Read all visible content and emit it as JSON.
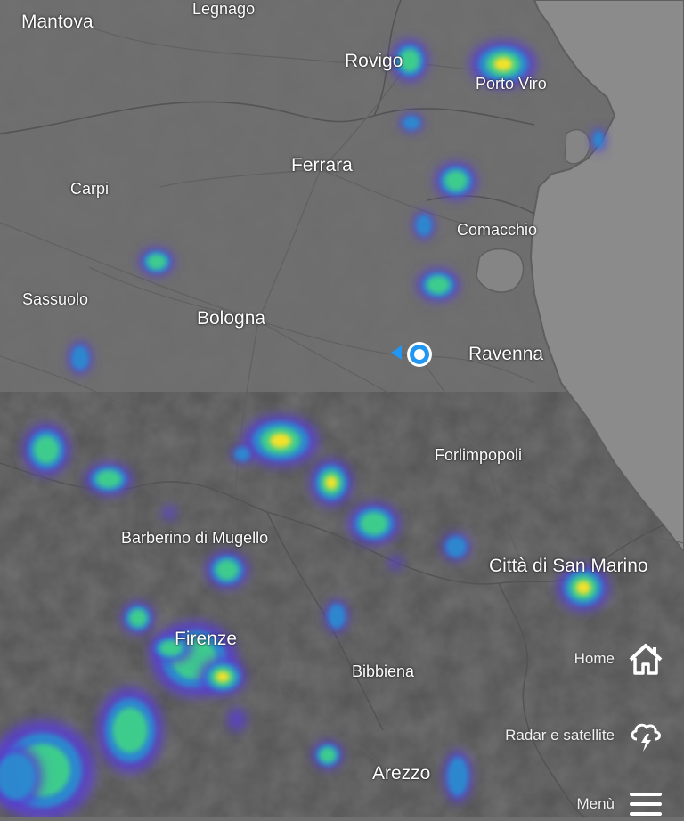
{
  "map": {
    "land_color": "#707070",
    "sea_color": "#8a8a8a",
    "border_color": "#505050",
    "road_color": "#5c5c5c"
  },
  "cities": [
    {
      "id": "mantova",
      "name": "Mantova"
    },
    {
      "id": "legnago",
      "name": "Legnago"
    },
    {
      "id": "rovigo",
      "name": "Rovigo"
    },
    {
      "id": "porto-viro",
      "name": "Porto Viro"
    },
    {
      "id": "ferrara",
      "name": "Ferrara"
    },
    {
      "id": "carpi",
      "name": "Carpi"
    },
    {
      "id": "comacchio",
      "name": "Comacchio"
    },
    {
      "id": "sassuolo",
      "name": "Sassuolo"
    },
    {
      "id": "bologna",
      "name": "Bologna"
    },
    {
      "id": "ravenna",
      "name": "Ravenna"
    },
    {
      "id": "forlimpopoli",
      "name": "Forlimpopoli"
    },
    {
      "id": "barberino",
      "name": "Barberino di Mugello"
    },
    {
      "id": "san-marino",
      "name": "Città di San Marino"
    },
    {
      "id": "firenze",
      "name": "Firenze"
    },
    {
      "id": "bibbiena",
      "name": "Bibbiena"
    },
    {
      "id": "arezzo",
      "name": "Arezzo"
    }
  ],
  "controls": {
    "home_label": "Home",
    "radar_label": "Radar e satellite",
    "menu_label": "Menù"
  },
  "radar_colors": {
    "low": "#5a3fd0",
    "mid": "#2a8bd0",
    "high": "#3fd08a",
    "peak": "#f2e22a"
  },
  "location_marker": {
    "color": "#2196f3"
  }
}
